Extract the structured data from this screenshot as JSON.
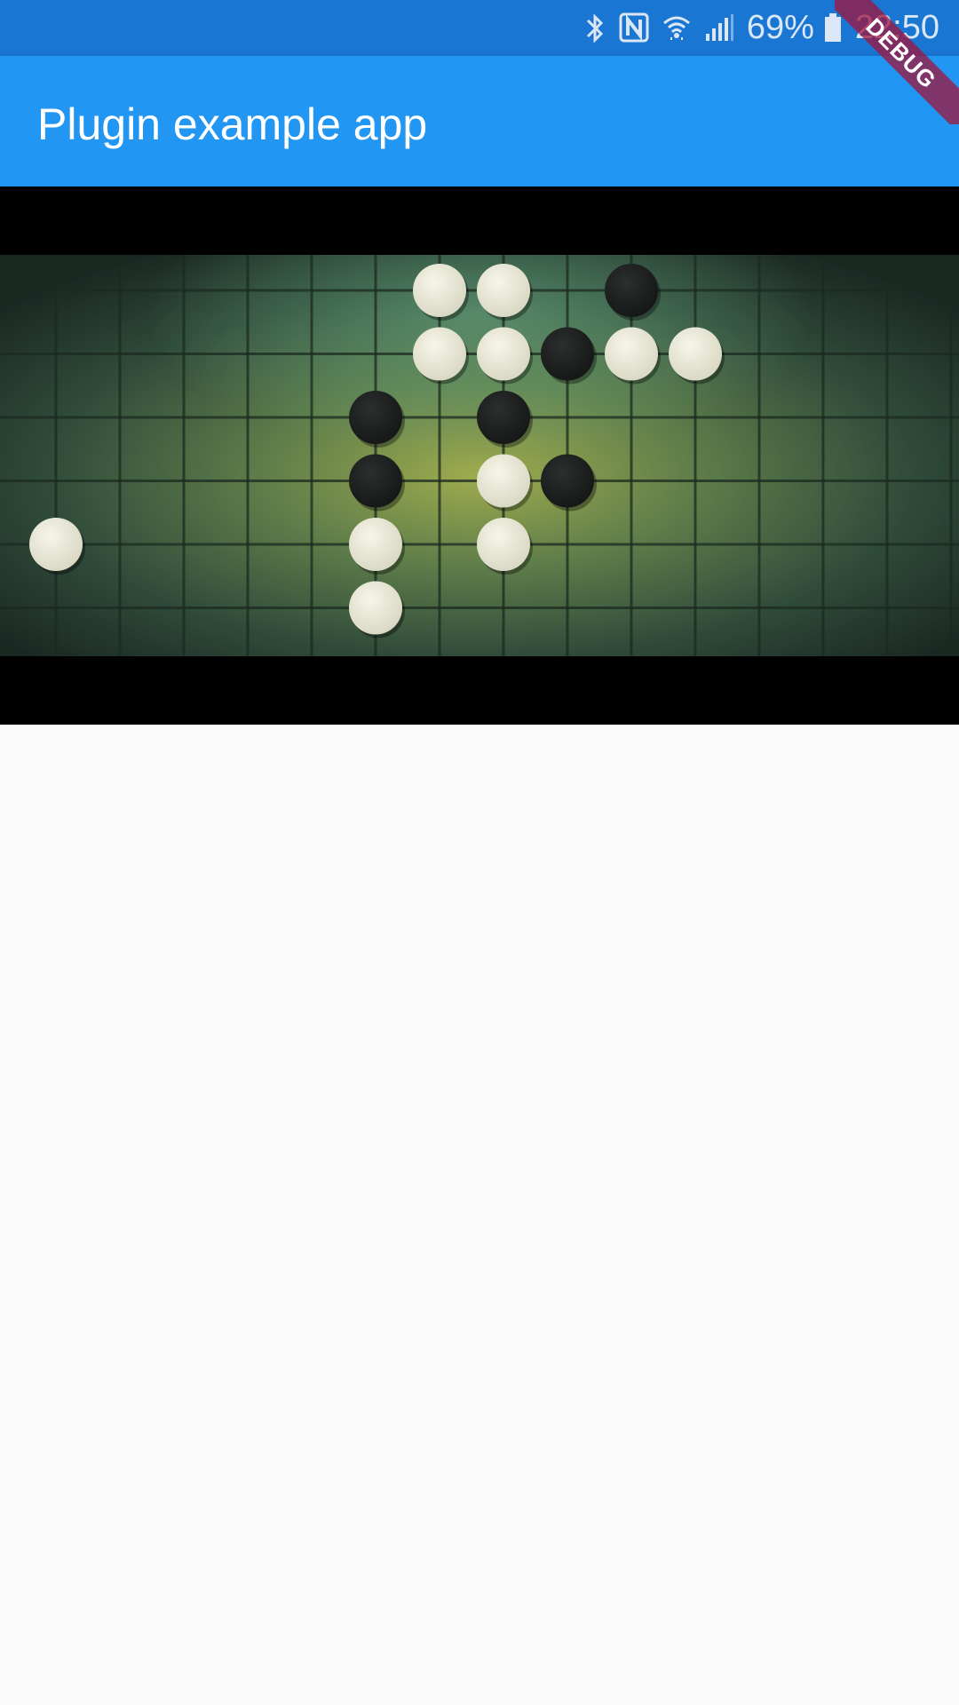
{
  "status_bar": {
    "battery_percent": "69%",
    "time": "22:50",
    "icons": [
      "bluetooth-icon",
      "nfc-icon",
      "wifi-icon",
      "signal-icon",
      "battery-icon"
    ]
  },
  "app_bar": {
    "title": "Plugin example app"
  },
  "debug_banner": {
    "label": "DEBUG"
  },
  "video": {
    "board": {
      "rows": 7,
      "cols": 15,
      "white_stones": [
        [
          0,
          6
        ],
        [
          0,
          7
        ],
        [
          1,
          6
        ],
        [
          1,
          7
        ],
        [
          1,
          9
        ],
        [
          1,
          10
        ],
        [
          3,
          7
        ],
        [
          4,
          0
        ],
        [
          4,
          5
        ],
        [
          4,
          7
        ],
        [
          5,
          5
        ]
      ],
      "black_stones": [
        [
          0,
          9
        ],
        [
          1,
          8
        ],
        [
          2,
          5
        ],
        [
          2,
          7
        ],
        [
          3,
          5
        ],
        [
          3,
          8
        ]
      ]
    }
  },
  "colors": {
    "status_bar": "#1976d2",
    "app_bar": "#2196f3",
    "background": "#fafafa",
    "stone_white": "#ecebd9",
    "stone_black": "#1f2121"
  }
}
